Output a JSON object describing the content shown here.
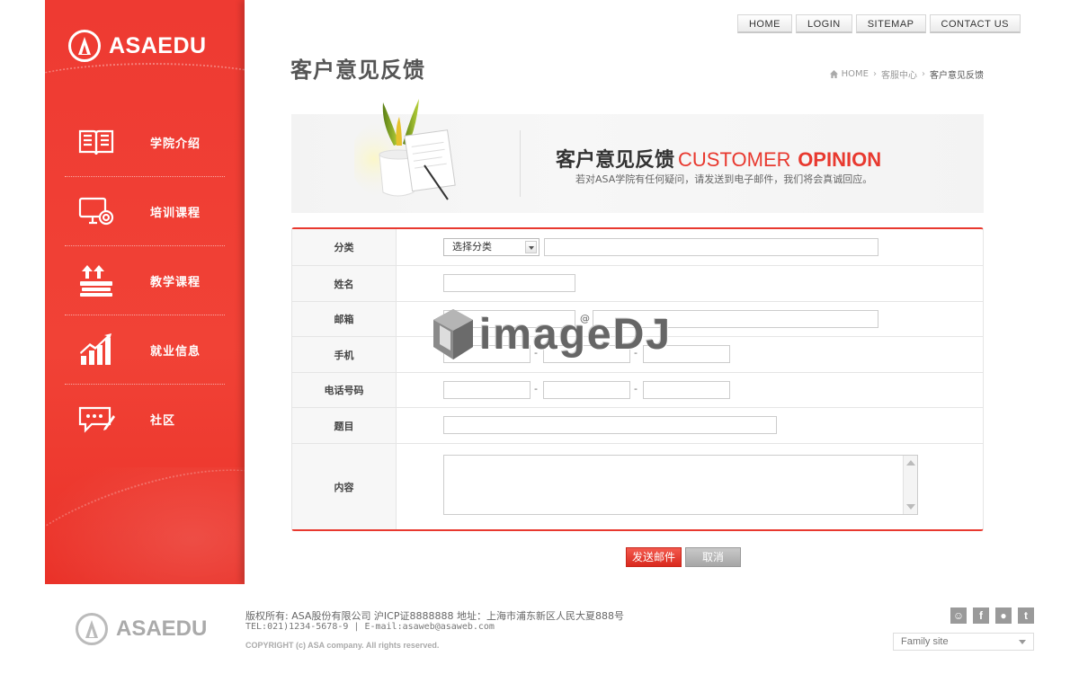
{
  "brand": {
    "name": "ASAEDU"
  },
  "sidebar": {
    "items": [
      {
        "label": "学院介绍",
        "icon": "book-icon"
      },
      {
        "label": "培训课程",
        "icon": "monitor-icon"
      },
      {
        "label": "教学课程",
        "icon": "stack-icon"
      },
      {
        "label": "就业信息",
        "icon": "growth-icon"
      },
      {
        "label": "社区",
        "icon": "chat-icon"
      }
    ]
  },
  "topnav": [
    "HOME",
    "LOGIN",
    "SITEMAP",
    "CONTACT US"
  ],
  "page": {
    "title": "客户意见反馈"
  },
  "breadcrumb": {
    "home": "HOME",
    "parent": "客服中心",
    "current": "客户意见反馈"
  },
  "banner": {
    "title_cn": "客户意见反馈",
    "title_en1": "CUSTOMER",
    "title_en2": "OPINION",
    "subtitle": "若对ASA学院有任何疑问，请发送到电子邮件，我们将会真诚回应。"
  },
  "form": {
    "category_label": "分类",
    "category_select": "选择分类",
    "name_label": "姓名",
    "email_label": "邮箱",
    "email_at": "@",
    "mobile_label": "手机",
    "phone_label": "电话号码",
    "subject_label": "题目",
    "content_label": "内容",
    "dash": "-"
  },
  "buttons": {
    "send": "发送邮件",
    "cancel": "取消"
  },
  "watermark": "imageDJ",
  "footer": {
    "line1": "版权所有: ASA股份有限公司 沪ICP证8888888 地址：上海市浦东新区人民大夏888号",
    "line2": "TEL:021)1234-5678-9 | E-mail:asaweb@asaweb.com",
    "line3": "COPYRIGHT (c) ASA company. All rights reserved.",
    "family_site": "Family site",
    "social": [
      "me2day-icon",
      "facebook-icon",
      "blog-icon",
      "twitter-icon"
    ]
  },
  "colors": {
    "accent": "#e8392f",
    "sidebar": "#ee3a32"
  }
}
